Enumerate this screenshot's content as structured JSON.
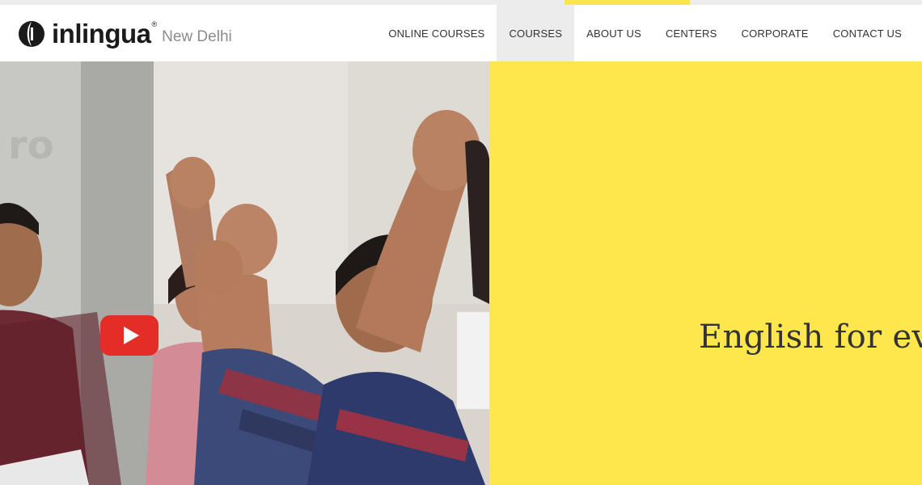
{
  "header": {
    "logo": {
      "brand": "inlingua",
      "registered": "®",
      "city": "New Delhi"
    },
    "nav": [
      {
        "label": "ONLINE COURSES",
        "active": false
      },
      {
        "label": "COURSES",
        "active": true
      },
      {
        "label": "ABOUT US",
        "active": false
      },
      {
        "label": "CENTERS",
        "active": false
      },
      {
        "label": "CORPORATE",
        "active": false
      },
      {
        "label": "CONTACT US",
        "active": false
      }
    ]
  },
  "hero": {
    "video": {
      "play_icon": "youtube-play-icon"
    },
    "tagline": "English for ever"
  },
  "colors": {
    "accent_yellow": "#fde74c",
    "nav_active_bg": "#ececec",
    "play_red": "#e52d27",
    "text_dark": "#333333",
    "city_gray": "#8c8c8c"
  }
}
